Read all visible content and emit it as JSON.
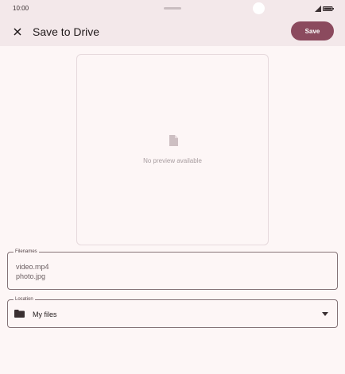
{
  "status_bar": {
    "time": "10:00",
    "icons": [
      "signal-icon",
      "battery-icon"
    ]
  },
  "app_bar": {
    "close_icon": "close-icon",
    "title": "Save to Drive",
    "save_label": "Save"
  },
  "preview": {
    "icon": "file-icon",
    "text": "No preview available"
  },
  "filenames": {
    "label": "Filenames",
    "items": [
      "video.mp4",
      "photo.jpg"
    ]
  },
  "location": {
    "label": "Location",
    "icon": "folder-icon",
    "value": "My files",
    "dropdown_icon": "dropdown-arrow-icon"
  },
  "colors": {
    "accent": "#8b4a5e",
    "background": "#fdf6f6",
    "app_bar_bg": "#f3e8ea",
    "outline": "#857377"
  }
}
